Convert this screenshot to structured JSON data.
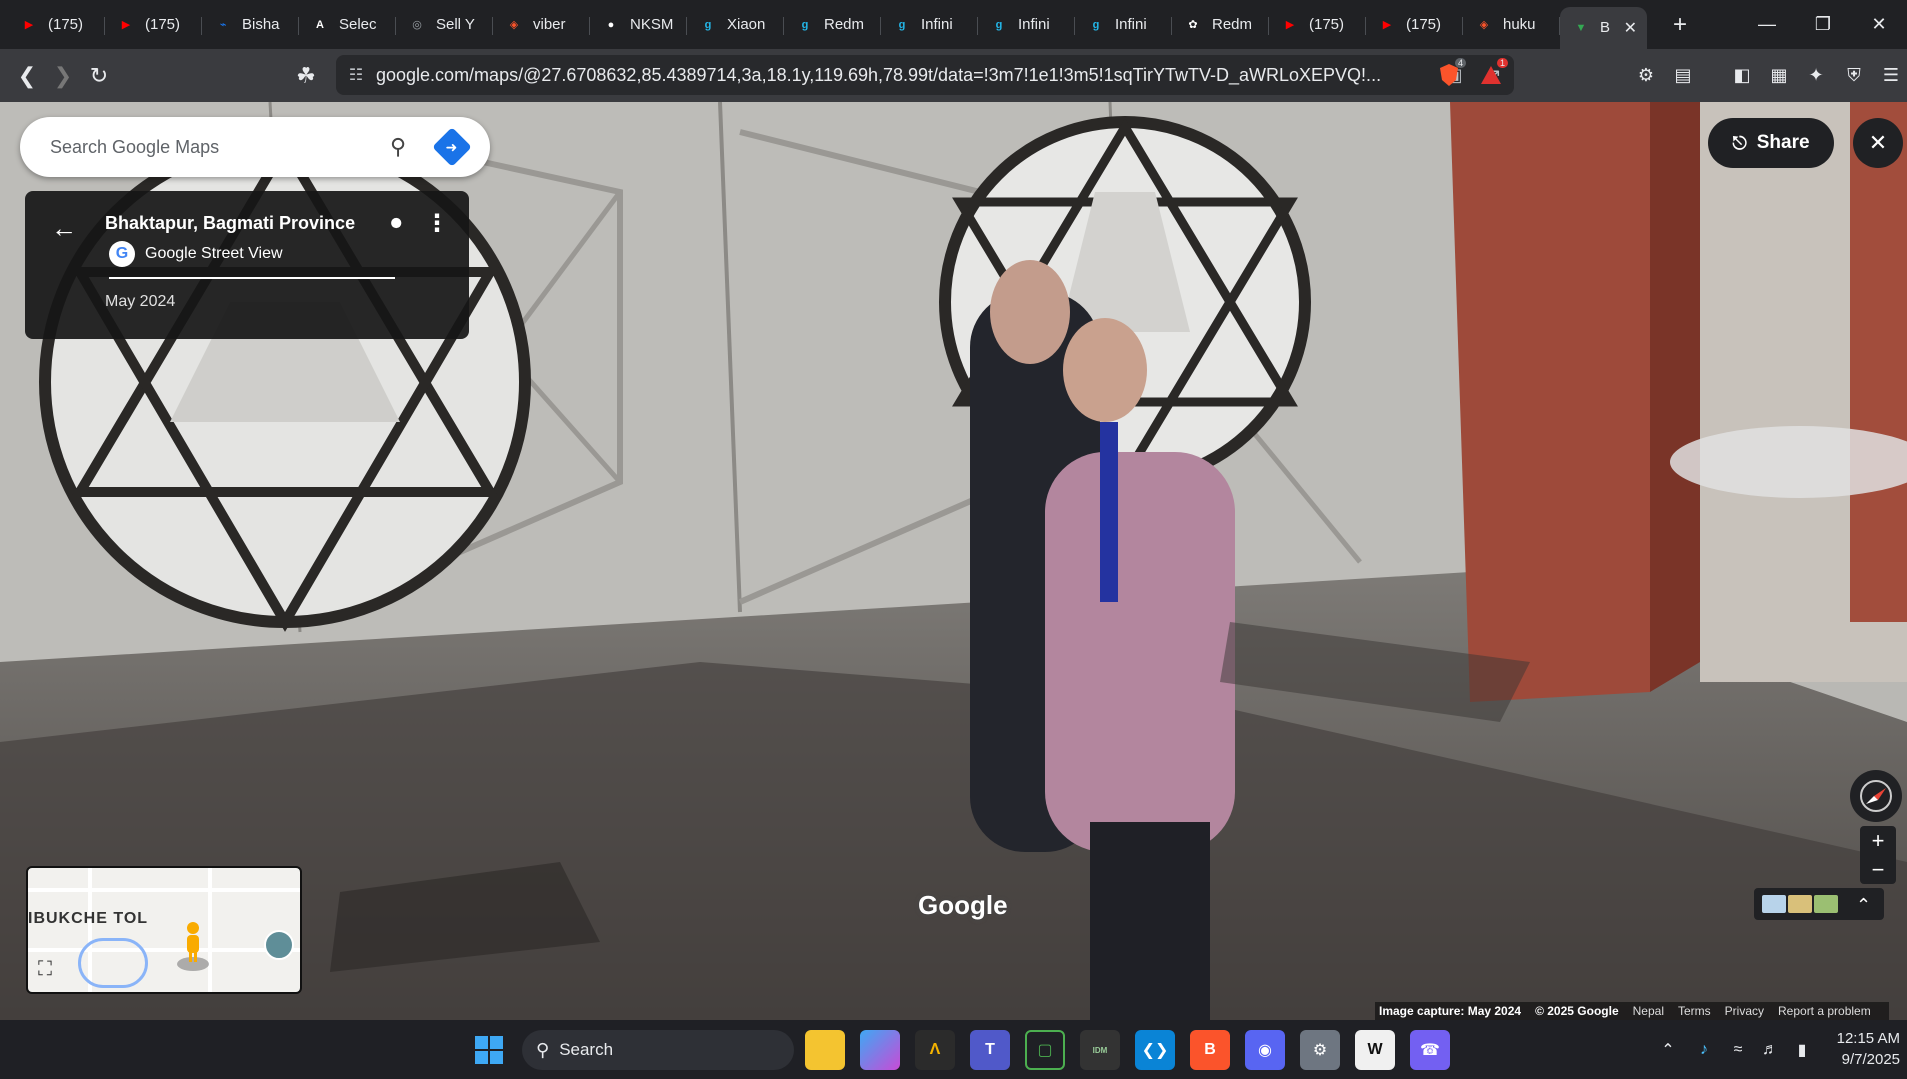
{
  "browser": {
    "tabs": [
      {
        "title": "(175)",
        "icon": "youtube-icon",
        "color": "#ff0000"
      },
      {
        "title": "(175)",
        "icon": "youtube-icon",
        "color": "#ff0000"
      },
      {
        "title": "Bisha",
        "icon": "messenger-icon",
        "color": "#1877f2"
      },
      {
        "title": "Selec",
        "icon": "app-icon",
        "color": "#ffffff"
      },
      {
        "title": "Sell Y",
        "icon": "globe-icon",
        "color": "#9aa0a6"
      },
      {
        "title": "viber",
        "icon": "brave-icon",
        "color": "#fb542b"
      },
      {
        "title": "NKSM",
        "icon": "github-icon",
        "color": "#ffffff"
      },
      {
        "title": "Xiaon",
        "icon": "gsmarena-icon",
        "color": "#23b6e8"
      },
      {
        "title": "Redm",
        "icon": "gsmarena-icon",
        "color": "#23b6e8"
      },
      {
        "title": "Infini",
        "icon": "gsmarena-icon",
        "color": "#23b6e8"
      },
      {
        "title": "Infini",
        "icon": "gsmarena-icon",
        "color": "#23b6e8"
      },
      {
        "title": "Infini",
        "icon": "gsmarena-icon",
        "color": "#23b6e8"
      },
      {
        "title": "Redm",
        "icon": "chatgpt-icon",
        "color": "#ffffff"
      },
      {
        "title": "(175)",
        "icon": "youtube-icon",
        "color": "#ff0000"
      },
      {
        "title": "(175)",
        "icon": "youtube-icon",
        "color": "#ff0000"
      },
      {
        "title": "huku",
        "icon": "brave-icon",
        "color": "#fb542b"
      }
    ],
    "active_tab": {
      "title": "B",
      "icon": "google-maps-icon"
    },
    "url": "google.com/maps/@27.6708632,85.4389714,3a,18.1y,119.69h,78.99t/data=!3m7!1e1!3m5!1sqTirYTwTV-D_aWRLoXEPVQ!...",
    "brave_badge": "4",
    "rewards_badge": "1"
  },
  "maps": {
    "search_placeholder": "Search Google Maps",
    "place_name": "Bhaktapur, Bagmati Province",
    "source": "Google Street View",
    "capture_date": "May 2024",
    "share_label": "Share",
    "minimap_label": "IBUKCHE TOL",
    "watermark": "Google",
    "footer": {
      "image_capture": "Image capture: May 2024",
      "copyright": "© 2025 Google",
      "country": "Nepal",
      "terms": "Terms",
      "privacy": "Privacy",
      "report": "Report a problem"
    }
  },
  "taskbar": {
    "search_label": "Search",
    "time": "12:15 AM",
    "date": "9/7/2025"
  },
  "colors": {
    "maps_accent": "#1a73e8",
    "chrome_dark": "#202124",
    "toolbar": "#3a3b3f"
  }
}
